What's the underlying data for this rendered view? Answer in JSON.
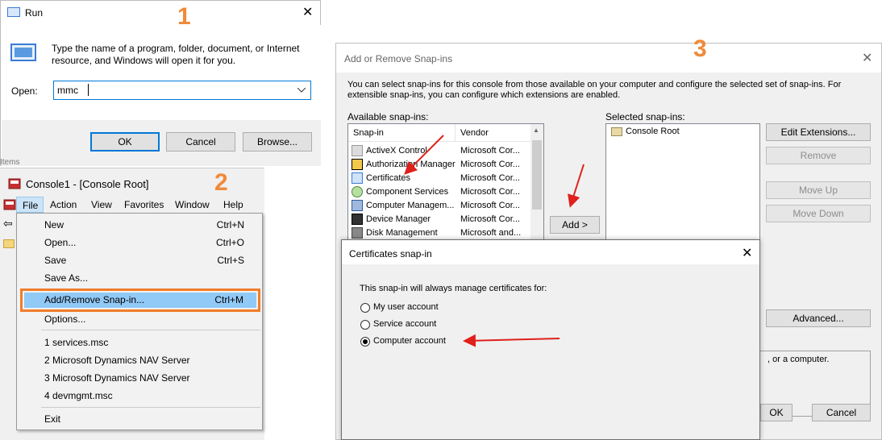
{
  "steps": {
    "one": "1",
    "two": "2",
    "three": "3"
  },
  "run": {
    "title": "Run",
    "description": "Type the name of a program, folder, document, or Internet resource, and Windows will open it for you.",
    "open_label": "Open:",
    "open_value": "mmc",
    "ok": "OK",
    "cancel": "Cancel",
    "browse": "Browse...",
    "close_glyph": "✕"
  },
  "partial_text": "Items",
  "mmc": {
    "title": "Console1 - [Console Root]",
    "menubar": [
      "File",
      "Action",
      "View",
      "Favorites",
      "Window",
      "Help"
    ],
    "file_menu": [
      {
        "label": "New",
        "shortcut": "Ctrl+N"
      },
      {
        "label": "Open...",
        "shortcut": "Ctrl+O"
      },
      {
        "label": "Save",
        "shortcut": "Ctrl+S"
      },
      {
        "label": "Save As...",
        "shortcut": ""
      },
      {
        "label": "Add/Remove Snap-in...",
        "shortcut": "Ctrl+M"
      },
      {
        "label": "Options...",
        "shortcut": ""
      },
      {
        "label": "1 services.msc",
        "shortcut": ""
      },
      {
        "label": "2 Microsoft Dynamics NAV Server",
        "shortcut": ""
      },
      {
        "label": "3 Microsoft Dynamics NAV Server",
        "shortcut": ""
      },
      {
        "label": "4 devmgmt.msc",
        "shortcut": ""
      },
      {
        "label": "Exit",
        "shortcut": ""
      }
    ]
  },
  "snapins": {
    "title": "Add or Remove Snap-ins",
    "intro": "You can select snap-ins for this console from those available on your computer and configure the selected set of snap-ins. For extensible snap-ins, you can configure which extensions are enabled.",
    "available_label": "Available snap-ins:",
    "selected_label": "Selected snap-ins:",
    "col_snapin": "Snap-in",
    "col_vendor": "Vendor",
    "rows": [
      {
        "name": "ActiveX Control",
        "vendor": "Microsoft Cor..."
      },
      {
        "name": "Authorization Manager",
        "vendor": "Microsoft Cor..."
      },
      {
        "name": "Certificates",
        "vendor": "Microsoft Cor..."
      },
      {
        "name": "Component Services",
        "vendor": "Microsoft Cor..."
      },
      {
        "name": "Computer Managem...",
        "vendor": "Microsoft Cor..."
      },
      {
        "name": "Device Manager",
        "vendor": "Microsoft Cor..."
      },
      {
        "name": "Disk Management",
        "vendor": "Microsoft and..."
      }
    ],
    "selected_item": "Console Root",
    "add": "Add >",
    "edit_extensions": "Edit Extensions...",
    "remove": "Remove",
    "move_up": "Move Up",
    "move_down": "Move Down",
    "advanced": "Advanced...",
    "desc_fragment": ", or a computer.",
    "ok": "OK",
    "cancel": "Cancel"
  },
  "cert": {
    "title": "Certificates snap-in",
    "prompt": "This snap-in will always manage certificates for:",
    "options": [
      "My user account",
      "Service account",
      "Computer account"
    ],
    "selected_option": "Computer account"
  },
  "colors": {
    "step": "#f08a3a",
    "highlight": "#91c9f7",
    "outline": "#f07d2a",
    "arrow": "#e0201b"
  }
}
